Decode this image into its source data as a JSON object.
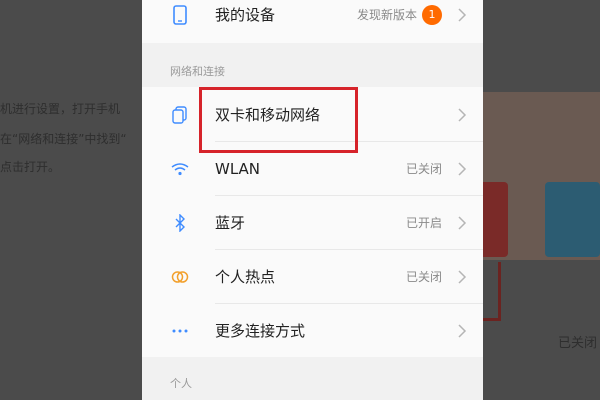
{
  "background_article": {
    "line1": "机进行设置，打开手机",
    "line2": "在“网络和连接”中找到“",
    "line3": "点击打开。",
    "right_text": "已关闭"
  },
  "settings": {
    "my_device": {
      "label": "我的设备",
      "status": "发现新版本",
      "badge": "1"
    },
    "network_section_title": "网络和连接",
    "items": [
      {
        "label": "双卡和移动网络",
        "status": "",
        "icon": "dual-sim-icon"
      },
      {
        "label": "WLAN",
        "status": "已关闭",
        "icon": "wifi-icon"
      },
      {
        "label": "蓝牙",
        "status": "已开启",
        "icon": "bluetooth-icon"
      },
      {
        "label": "个人热点",
        "status": "已关闭",
        "icon": "hotspot-icon"
      },
      {
        "label": "更多连接方式",
        "status": "",
        "icon": "more-dots-icon"
      }
    ],
    "personal_section_title": "个人"
  },
  "colors": {
    "accent_blue": "#3f8cff",
    "hotspot_orange": "#f2a02c",
    "badge_orange": "#ff6a00",
    "highlight_red": "#d6232a"
  }
}
